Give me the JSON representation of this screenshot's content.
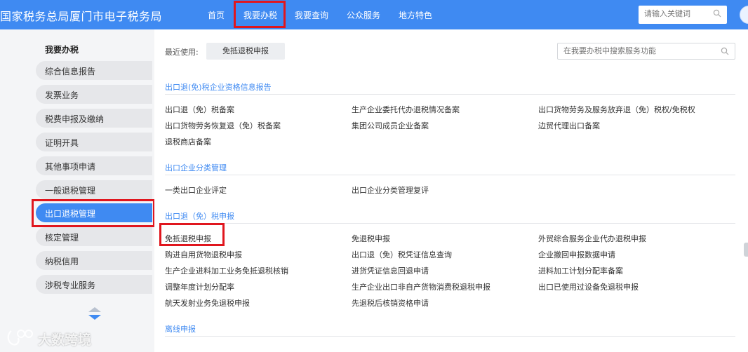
{
  "header": {
    "site_title": "国家税务总局厦门市电子税务局",
    "nav": [
      "首页",
      "我要办税",
      "我要查询",
      "公众服务",
      "地方特色"
    ],
    "active_nav": "我要办税",
    "search_placeholder": "请输入关键词",
    "search_icon": "search-icon"
  },
  "sidebar": {
    "heading": "我要办税",
    "items": [
      "综合信息报告",
      "发票业务",
      "税费申报及缴纳",
      "证明开具",
      "其他事项申请",
      "一般退税管理",
      "出口退税管理",
      "核定管理",
      "纳税信用",
      "涉税专业服务"
    ],
    "active_item": "出口退税管理"
  },
  "main": {
    "recent_label": "最近使用:",
    "recent_item": "免抵退税申报",
    "search_placeholder": "在我要办税中搜索服务功能",
    "sections": [
      {
        "title": "出口退(免)税企业资格信息报告",
        "items": [
          "出口退（免）税备案",
          "生产企业委托代办退税情况备案",
          "出口货物劳务及服务放弃退（免）税权/免税权",
          "出口货物劳务恢复退（免）税备案",
          "集团公司成员企业备案",
          "边贸代理出口备案",
          "退税商店备案"
        ]
      },
      {
        "title": "出口企业分类管理",
        "items": [
          "一类出口企业评定",
          "出口企业分类管理复评"
        ]
      },
      {
        "title": "出口退（免）税申报",
        "items": [
          "免抵退税申报",
          "免退税申报",
          "外贸综合服务企业代办退税申报",
          "购进自用货物退税申报",
          "出口退（免）税凭证信息查询",
          "企业撤回申报数据申请",
          "生产企业进料加工业务免抵退税核销",
          "进货凭证信息回退申请",
          "进料加工计划分配率备案",
          "调整年度计划分配率",
          "生产企业出口非自产货物消费税退税申报",
          "出口已使用过设备免退税申报",
          "航天发射业务免退税申报",
          "先退税后核销资格申请"
        ]
      },
      {
        "title": "离线申报",
        "items": []
      }
    ]
  },
  "watermark": {
    "text": "大数跨境"
  },
  "colors": {
    "brand": "#3f8af2",
    "highlight": "#e0161e",
    "sidebar_bg": "#e6e7ea"
  }
}
